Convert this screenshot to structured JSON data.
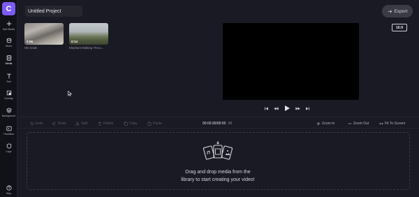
{
  "app": {
    "logo_letter": "C"
  },
  "sidebar": {
    "items": [
      {
        "label": "Add Media",
        "icon": "plus-icon"
      },
      {
        "label": "Stock",
        "icon": "stock-icon"
      },
      {
        "label": "Media",
        "icon": "media-icon",
        "active": true
      },
      {
        "label": "Text",
        "icon": "text-icon"
      },
      {
        "label": "Overlay",
        "icon": "overlay-icon"
      },
      {
        "label": "Background",
        "icon": "layers-icon"
      },
      {
        "label": "Transition",
        "icon": "transition-icon"
      },
      {
        "label": "Logo",
        "icon": "shield-icon"
      },
      {
        "label": "Help",
        "icon": "help-icon"
      }
    ]
  },
  "header": {
    "project_title": "Untitled Project",
    "export_label": "Export"
  },
  "library": {
    "items": [
      {
        "duration": "0:06",
        "caption": "HD Seals"
      },
      {
        "duration": "0:14",
        "caption": "Elephant Walking Throu..."
      }
    ]
  },
  "preview": {
    "aspect_ratio": "16:9",
    "controls": [
      "skip-back-icon",
      "rewind-icon",
      "play-icon",
      "fast-forward-icon",
      "skip-forward-icon"
    ]
  },
  "toolbar": {
    "undo": "Undo",
    "redo": "Redo",
    "split": "Split",
    "delete": "Delete",
    "copy": "Copy",
    "paste": "Paste",
    "time_current": "00:00",
    "time_current_frac": ".00",
    "time_sep": " / ",
    "time_total": "00:00",
    "time_total_frac": ".00",
    "zoom_in": "Zoom In",
    "zoom_out": "Zoom Out",
    "fit": "Fit To Screen"
  },
  "dropzone": {
    "line1": "Drag and drop media from the",
    "line2": "library to start creating your video!"
  },
  "colors": {
    "background": "#1a1a24",
    "rail": "#111118",
    "accent": "#7b5cf0",
    "preview": "#000000"
  }
}
